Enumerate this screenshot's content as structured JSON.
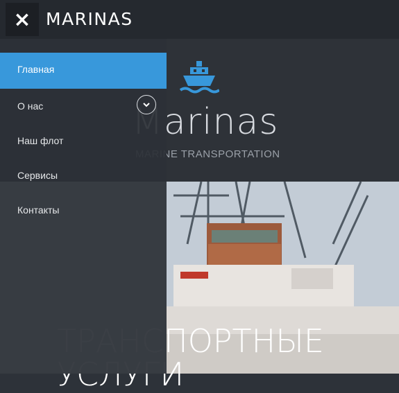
{
  "header": {
    "title": "MARINAS",
    "close_icon": "×"
  },
  "menu": {
    "items": [
      {
        "label": "Главная",
        "active": true
      },
      {
        "label": "О нас",
        "has_submenu": true
      },
      {
        "label": "Наш флот"
      },
      {
        "label": "Сервисы"
      },
      {
        "label": "Контакты"
      }
    ]
  },
  "brand": {
    "title": "Marinas",
    "subtitle": "MARINE TRANSPORTATION"
  },
  "hero": {
    "line1": "ТРАНСПОРТНЫЕ",
    "line2": "УСЛУГИ"
  },
  "colors": {
    "accent": "#3898db",
    "header_bg": "#25292f",
    "menu_bg": "#2c3037"
  }
}
